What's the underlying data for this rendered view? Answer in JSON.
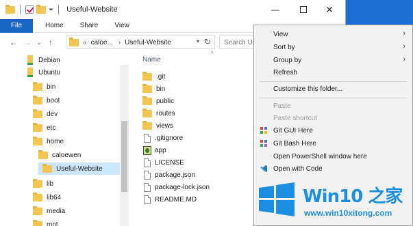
{
  "window": {
    "title": "Useful-Website",
    "minimize": "—",
    "close": "✕"
  },
  "ribbon": {
    "tabs": [
      "File",
      "Home",
      "Share",
      "View"
    ]
  },
  "navbar": {
    "back": "←",
    "forward": "→",
    "recent": "⌄",
    "up": "↑",
    "path_prefix": "«",
    "path": [
      "caloe...",
      "Useful-Website"
    ],
    "refresh": "↻",
    "search_placeholder": "Search Us"
  },
  "nav_tree": [
    {
      "label": "Debian",
      "icon": "linux-drive-icon",
      "indent": 1
    },
    {
      "label": "Ubuntu",
      "icon": "linux-drive-icon",
      "indent": 1
    },
    {
      "label": "bin",
      "icon": "folder-icon",
      "indent": 2
    },
    {
      "label": "boot",
      "icon": "folder-icon",
      "indent": 2
    },
    {
      "label": "dev",
      "icon": "folder-icon",
      "indent": 2
    },
    {
      "label": "etc",
      "icon": "folder-icon",
      "indent": 2
    },
    {
      "label": "home",
      "icon": "folder-icon",
      "indent": 2
    },
    {
      "label": "caloewen",
      "icon": "folder-icon",
      "indent": 3
    },
    {
      "label": "Useful-Website",
      "icon": "folder-icon",
      "indent": 4,
      "selected": true
    },
    {
      "label": "lib",
      "icon": "folder-icon",
      "indent": 2
    },
    {
      "label": "lib64",
      "icon": "folder-icon",
      "indent": 2
    },
    {
      "label": "media",
      "icon": "folder-icon",
      "indent": 2
    },
    {
      "label": "mnt",
      "icon": "folder-icon",
      "indent": 2
    }
  ],
  "content": {
    "column_name": "Name",
    "sort_indicator": "^",
    "files": [
      {
        "name": ".git",
        "icon": "folder-icon"
      },
      {
        "name": "bin",
        "icon": "folder-icon"
      },
      {
        "name": "public",
        "icon": "folder-icon"
      },
      {
        "name": "routes",
        "icon": "folder-icon"
      },
      {
        "name": "views",
        "icon": "folder-icon"
      },
      {
        "name": ".gitignore",
        "icon": "file-icon"
      },
      {
        "name": "app",
        "icon": "app-icon"
      },
      {
        "name": "LICENSE",
        "icon": "file-icon"
      },
      {
        "name": "package.json",
        "icon": "file-icon"
      },
      {
        "name": "package-lock.json",
        "icon": "file-icon"
      },
      {
        "name": "README.MD",
        "icon": "file-icon"
      }
    ]
  },
  "context_menu": {
    "items": [
      {
        "label": "View",
        "submenu": true
      },
      {
        "label": "Sort by",
        "submenu": true
      },
      {
        "label": "Group by",
        "submenu": true
      },
      {
        "label": "Refresh"
      },
      {
        "separator": true
      },
      {
        "label": "Customize this folder..."
      },
      {
        "separator": true
      },
      {
        "label": "Paste",
        "disabled": true
      },
      {
        "label": "Paste shortcut",
        "disabled": true
      },
      {
        "label": "Git GUI Here",
        "icon": "git-gui-icon"
      },
      {
        "label": "Git Bash Here",
        "icon": "git-bash-icon"
      },
      {
        "label": "Open PowerShell window here"
      },
      {
        "label": "Open with Code",
        "icon": "vscode-icon"
      }
    ]
  },
  "watermark": {
    "brand": "Win10 之家",
    "url": "www.win10xitong.com"
  },
  "colors": {
    "file_tab": "#1a66c4",
    "selection": "#cce6ff",
    "folder": "#f3c553",
    "watermark": "#1e8fe0",
    "desktop": "#1f6fd2"
  }
}
